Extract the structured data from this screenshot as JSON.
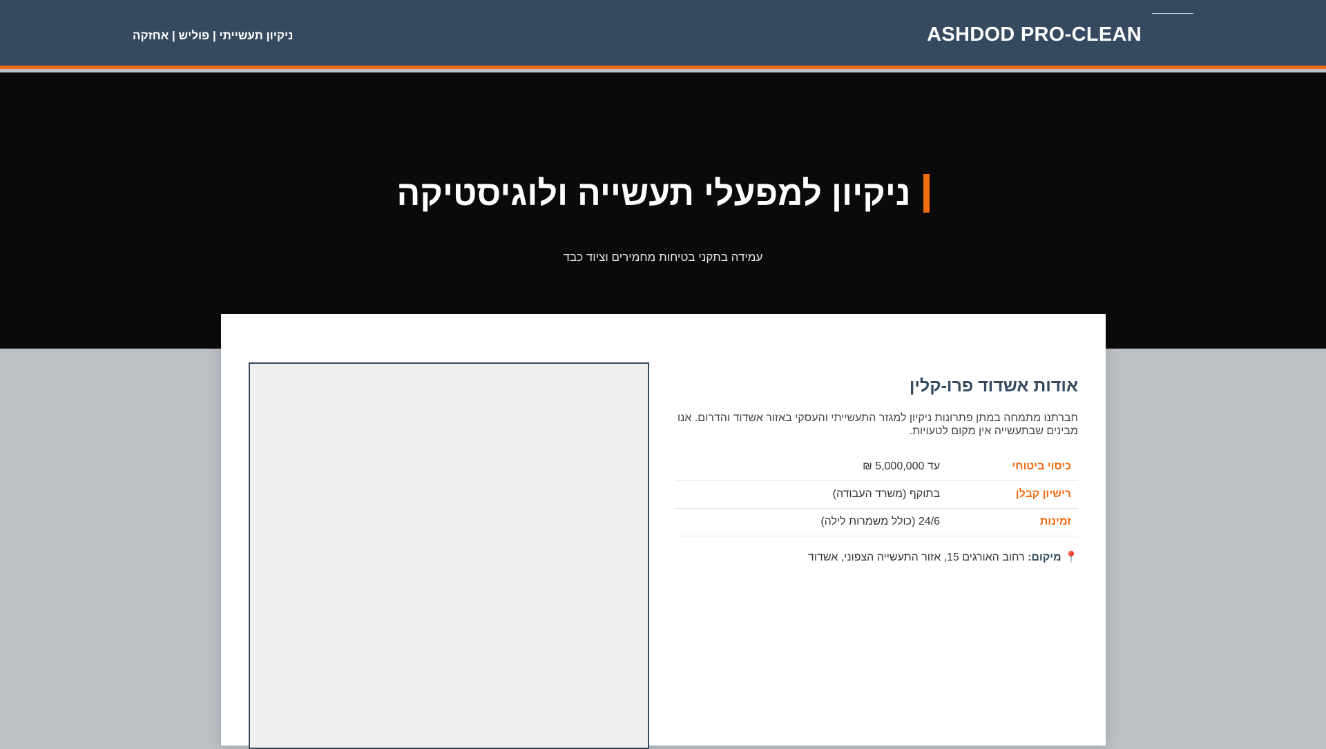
{
  "header": {
    "brand": "ASHDOD PRO-CLEAN",
    "tagline": "ניקיון תעשייתי | פוליש | אחזקה",
    "accent_color": "#f06b12",
    "bg_color": "#354a5f"
  },
  "hero": {
    "title": "ניקיון למפעלי תעשייה ולוגיסטיקה",
    "subtitle": "עמידה בתקני בטיחות מחמירים וציוד כבד"
  },
  "about": {
    "heading": "אודות אשדוד פרו-קלין",
    "description": "חברתנו מתמחה במתן פתרונות ניקיון למגזר התעשייתי והעסקי באזור אשדוד והדרום. אנו מבינים שבתעשייה אין מקום לטעויות.",
    "rows": [
      {
        "label": "כיסוי ביטוחי",
        "value": "עד 5,000,000 ₪"
      },
      {
        "label": "רישיון קבלן",
        "value": "בתוקף (משרד העבודה)"
      },
      {
        "label": "זמינות",
        "value": "24/6 (כולל משמרות לילה)"
      }
    ],
    "location_icon": "map-pin-icon",
    "location_label": "מיקום:",
    "location_value": "רחוב האורגים 15, אזור התעשייה הצפוני, אשדוד"
  }
}
